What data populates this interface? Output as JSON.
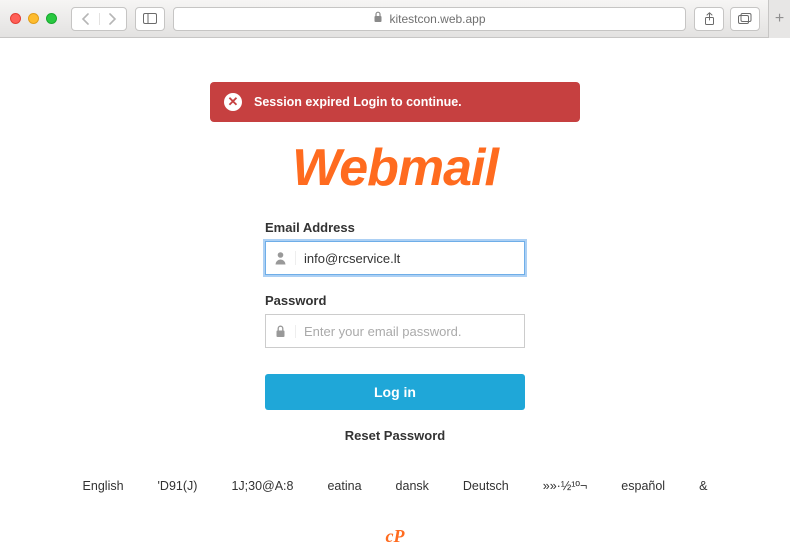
{
  "browser": {
    "url_host": "kitestcon.web.app"
  },
  "alert": {
    "message": "Session expired Login to continue."
  },
  "logo_text": "Webmail",
  "form": {
    "email_label": "Email Address",
    "email_value": "info@rcservice.lt",
    "password_label": "Password",
    "password_placeholder": "Enter your email password.",
    "login_label": "Log in",
    "reset_label": "Reset Password"
  },
  "languages": [
    "English",
    "'D91(J)",
    "1J;30@A:8",
    "eatina",
    "dansk",
    "Deutsch",
    "»»·½¹º¬",
    "español",
    "&"
  ],
  "footer_brand": "cP"
}
